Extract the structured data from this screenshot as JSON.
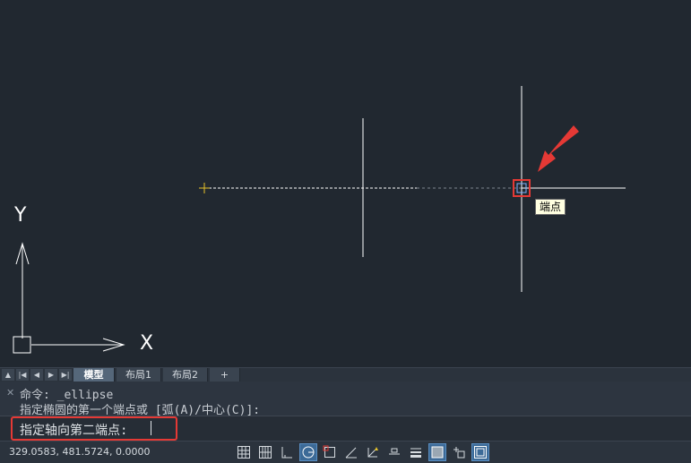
{
  "tooltip": {
    "snap_label": "端点"
  },
  "ucs": {
    "x_label": "X",
    "y_label": "Y"
  },
  "tabs": {
    "nav": [
      "▲",
      "|◀",
      "◀",
      "▶",
      "▶|"
    ],
    "items": [
      {
        "label": "模型",
        "active": true
      },
      {
        "label": "布局1",
        "active": false
      },
      {
        "label": "布局2",
        "active": false
      },
      {
        "label": "+",
        "active": false
      }
    ]
  },
  "command": {
    "history": [
      "命令: _ellipse",
      "指定椭圆的第一个端点或 [弧(A)/中心(C)]:"
    ],
    "prompt": "指定轴向第二端点: "
  },
  "status": {
    "coordinates": "329.0583, 481.5724, 0.0000",
    "buttons": [
      {
        "icon": "grid-display-icon",
        "on": false
      },
      {
        "icon": "snap-grid-icon",
        "on": false
      },
      {
        "icon": "ortho-icon",
        "on": false
      },
      {
        "icon": "polar-tracking-icon",
        "on": true
      },
      {
        "icon": "object-snap-icon",
        "on": false
      },
      {
        "icon": "object-snap-tracking-icon",
        "on": false
      },
      {
        "icon": "dynamic-ucs-icon",
        "on": false
      },
      {
        "icon": "dynamic-input-icon",
        "on": false
      },
      {
        "icon": "lineweight-icon",
        "on": false
      },
      {
        "icon": "transparency-icon",
        "on": true
      },
      {
        "icon": "selection-cycling-icon",
        "on": false
      },
      {
        "icon": "annotation-monitor-icon",
        "on": true
      }
    ]
  },
  "colors": {
    "canvas": "#212830",
    "crosshair": "#ffffff",
    "first_point_marker": "#e6c229",
    "snap_marker_box": "#e53935",
    "annotation_arrow": "#e53935"
  }
}
